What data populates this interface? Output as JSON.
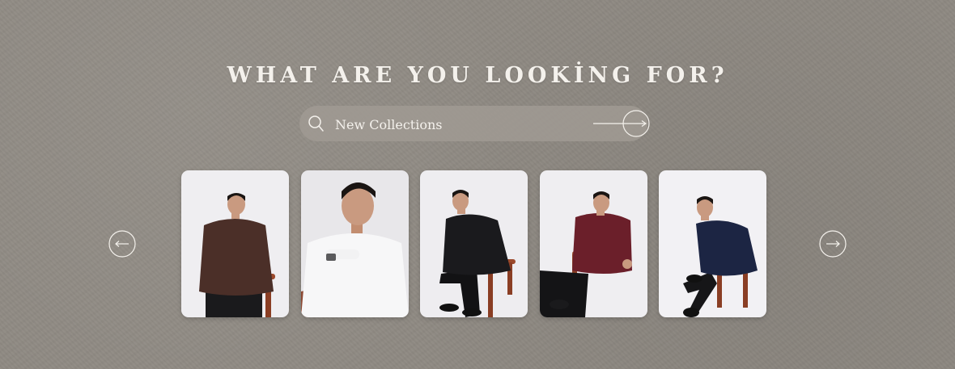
{
  "headline": "WHAT ARE YOU LOOKİNG FOR?",
  "search": {
    "value": "",
    "placeholder": "New Collections",
    "icon": "search-icon",
    "submit_icon": "arrow-right-circle-icon"
  },
  "carousel": {
    "prev_icon": "arrow-left-circle-icon",
    "next_icon": "arrow-right-circle-icon",
    "items": [
      {
        "icon": "model-photo-brown-shirt",
        "shirt_color": "#4b2f28"
      },
      {
        "icon": "model-photo-white-shirt",
        "shirt_color": "#f5f5f5"
      },
      {
        "icon": "model-photo-black-shirt",
        "shirt_color": "#1a1a1d"
      },
      {
        "icon": "model-photo-maroon-shirt",
        "shirt_color": "#6b1f2a"
      },
      {
        "icon": "model-photo-navy-shirt",
        "shirt_color": "#1c2543"
      }
    ]
  },
  "colors": {
    "background": "#8f8a83",
    "text": "#f4f1ec",
    "search_bg": "#a09a93",
    "card_bg": "#eeedf0"
  }
}
